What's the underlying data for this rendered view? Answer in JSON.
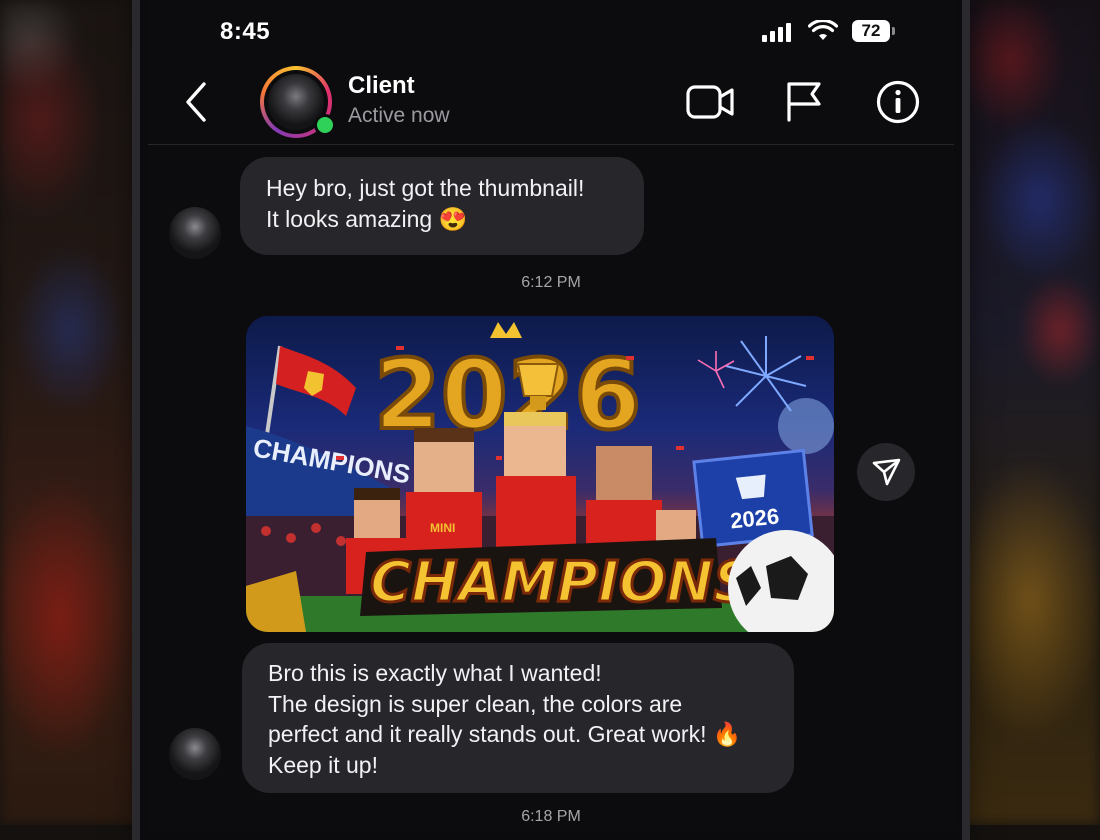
{
  "status": {
    "time": "8:45",
    "battery": "72"
  },
  "header": {
    "name": "Client",
    "status": "Active now"
  },
  "messages": {
    "m1": {
      "line1": "Hey bro, just got the thumbnail!",
      "line2": "It looks amazing 😍"
    },
    "t1": "6:12 PM",
    "thumbnail": {
      "year": "2026",
      "banner": "CHAMPIONS",
      "stadium_sign": "CHAMPIONS",
      "board_year": "2026",
      "jersey": "MINI"
    },
    "m2": {
      "line1": "Bro this is exactly what I wanted!",
      "line2": "The design is super clean, the colors are",
      "line3": "perfect and it really stands out. Great work! 🔥",
      "line4": "Keep it up!"
    },
    "t2": "6:18 PM"
  },
  "colors": {
    "online": "#30d158",
    "bubble": "#26262b",
    "background": "#0c0c0e"
  },
  "icons": [
    "back-icon",
    "video-call-icon",
    "flag-icon",
    "info-icon",
    "share-icon",
    "wifi-icon",
    "signal-icon",
    "battery-icon"
  ]
}
